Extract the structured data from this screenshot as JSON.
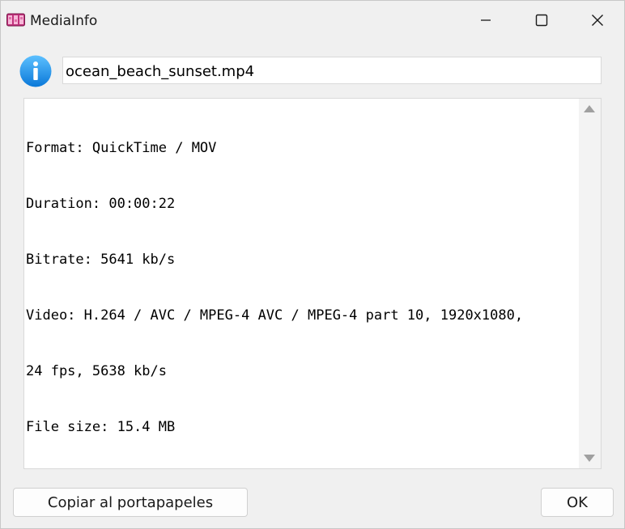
{
  "window": {
    "title": "MediaInfo",
    "icon": "film-strip-icon"
  },
  "controls": {
    "minimize_icon": "minimize-icon",
    "maximize_icon": "maximize-icon",
    "close_icon": "close-icon"
  },
  "file": {
    "icon": "info-icon",
    "name": "ocean_beach_sunset.mp4"
  },
  "info": {
    "lines": [
      "Format: QuickTime / MOV",
      "Duration: 00:00:22",
      "Bitrate: 5641 kb/s",
      "Video: H.264 / AVC / MPEG-4 AVC / MPEG-4 part 10, 1920x1080,",
      "24 fps, 5638 kb/s",
      "File size: 15.4 MB"
    ]
  },
  "buttons": {
    "copy_label": "Copiar al portapapeles",
    "ok_label": "OK"
  },
  "colors": {
    "accent": "#1e90e8",
    "window_bg": "#f0f0f0"
  }
}
